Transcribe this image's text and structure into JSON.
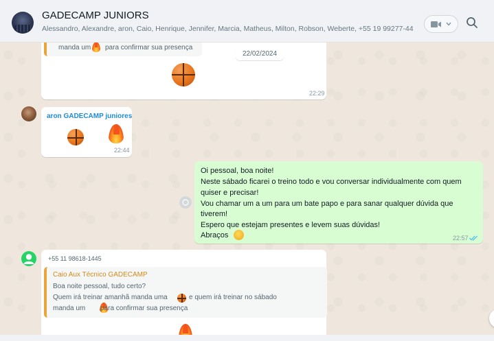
{
  "header": {
    "group_name": "GADECAMP JUNIORS",
    "members": "Alessandro, Alexandre, aron, Caio, Henrique, Jennifer, Marcia, Matheus, Milton, Robson, Weberte, +55 19 99277-44...",
    "video_icon": "video-camera-icon",
    "dropdown_icon": "chevron-down-icon",
    "search_icon": "search-icon"
  },
  "messages": {
    "m1": {
      "quote_tail_part1": "manda um",
      "quote_tail_part2": "para confirmar sua presença",
      "date_badge": "22/02/2024",
      "time": "22:29"
    },
    "m2": {
      "sender": "aron GADECAMP juniores",
      "time": "22:44"
    },
    "m3": {
      "lines": [
        "Oi pessoal, boa noite!",
        "Neste sábado ficarei o treino todo e vou conversar individualmente com quem",
        "quiser e precisar!",
        "Vou chamar um a um para um bate papo e para sanar qualquer dúvida que",
        "tiverem!",
        "Espero que estejam presentes e levem suas dúvidas!",
        "Abraços"
      ],
      "time": "22:57",
      "status_icon": "double-check-icon"
    },
    "m4": {
      "sender_phone": "+55 11 98618-1445",
      "quote_author": "Caio Aux Técnico GADECAMP",
      "quote_line1": "Boa noite pessoal, tudo certo?",
      "quote_line2a": "Quem irá treinar amanhã manda uma",
      "quote_line2b": "e quem irá treinar no sábado",
      "quote_line3a": "manda um",
      "quote_line3b": "para confirmar sua presença"
    }
  },
  "colors": {
    "outgoing_bubble": "#d9fdd3",
    "incoming_bubble": "#ffffff",
    "quote_bar": "#e7a53c",
    "sender_blue": "#1f8bd6",
    "quote_author_orange": "#d68a1c",
    "read_tick": "#53bdeb"
  }
}
